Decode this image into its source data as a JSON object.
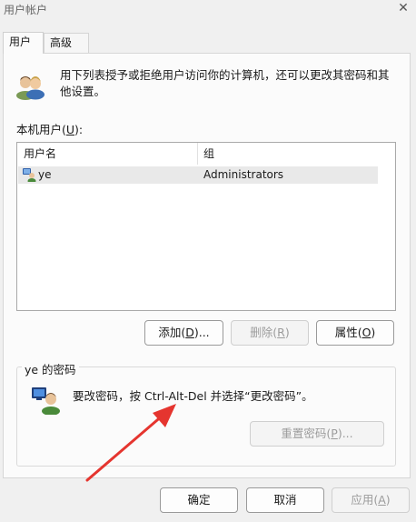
{
  "window": {
    "title": "用户帐户",
    "close_glyph": "✕"
  },
  "tabs": [
    {
      "label": "用户",
      "active": true
    },
    {
      "label": "高级",
      "active": false
    }
  ],
  "description": "用下列表授予或拒绝用户访问你的计算机，还可以更改其密码和其他设置。",
  "local_users": {
    "label": "本机用户(U):",
    "columns": [
      "用户名",
      "组"
    ],
    "rows": [
      {
        "name": "ye",
        "group": "Administrators",
        "icon": "user-icon"
      }
    ]
  },
  "buttons": {
    "add": "添加(D)...",
    "remove": "删除(R)",
    "properties": "属性(O)"
  },
  "password": {
    "title": "ye 的密码",
    "text": "要改密码，按 Ctrl-Alt-Del 并选择“更改密码”。",
    "reset": "重置密码(P)..."
  },
  "footer": {
    "ok": "确定",
    "cancel": "取消",
    "apply": "应用(A)"
  },
  "colors": {
    "accent": "#0067c0",
    "annotation_arrow": "#e5352f",
    "row_selected": "#e9e9e9"
  }
}
